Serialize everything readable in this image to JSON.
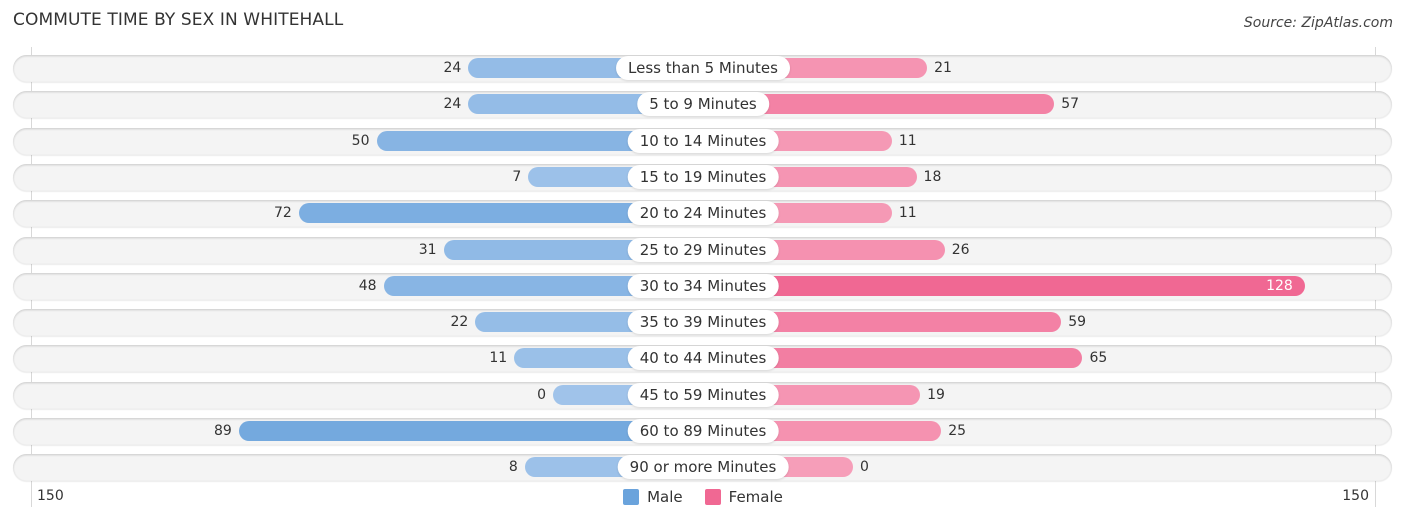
{
  "header": {
    "title": "COMMUTE TIME BY SEX IN WHITEHALL",
    "source": "Source: ZipAtlas.com"
  },
  "colors": {
    "male": "#6aa3dc",
    "female": "#f06893",
    "male_light": "#a9c9ec",
    "female_light": "#f7a8c0"
  },
  "chart_data": {
    "type": "bar",
    "orientation": "horizontal-diverging",
    "title": "COMMUTE TIME BY SEX IN WHITEHALL",
    "categories": [
      "Less than 5 Minutes",
      "5 to 9 Minutes",
      "10 to 14 Minutes",
      "15 to 19 Minutes",
      "20 to 24 Minutes",
      "25 to 29 Minutes",
      "30 to 34 Minutes",
      "35 to 39 Minutes",
      "40 to 44 Minutes",
      "45 to 59 Minutes",
      "60 to 89 Minutes",
      "90 or more Minutes"
    ],
    "series": [
      {
        "name": "Male",
        "values": [
          24,
          24,
          50,
          7,
          72,
          31,
          48,
          22,
          11,
          0,
          89,
          8
        ]
      },
      {
        "name": "Female",
        "values": [
          21,
          57,
          11,
          18,
          11,
          26,
          128,
          59,
          65,
          19,
          25,
          0
        ]
      }
    ],
    "axis": {
      "min_label": "150",
      "max_label": "150",
      "range": [
        0,
        150
      ]
    },
    "legend": {
      "position": "bottom-center",
      "entries": [
        "Male",
        "Female"
      ]
    },
    "grid": false
  }
}
